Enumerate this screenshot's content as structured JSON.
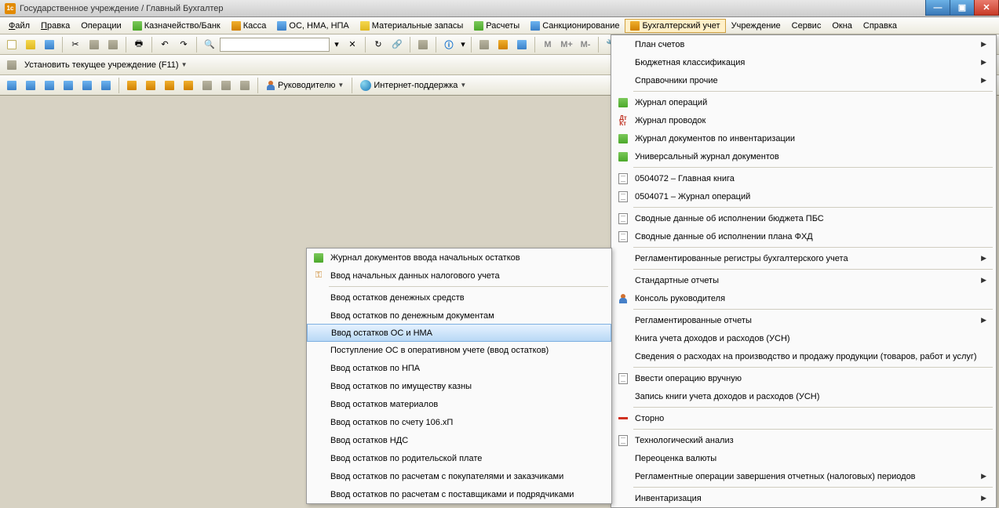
{
  "titlebar": {
    "title": "Государственное учреждение / Главный Бухгалтер"
  },
  "menubar": {
    "items": [
      {
        "label": "Файл",
        "u": 0
      },
      {
        "label": "Правка",
        "u": 0
      },
      {
        "label": "Операции",
        "u": -1
      },
      {
        "label": "Казначейство/Банк",
        "icon": "green"
      },
      {
        "label": "Касса",
        "icon": "orange"
      },
      {
        "label": "ОС, НМА, НПА",
        "icon": "blue"
      },
      {
        "label": "Материальные запасы",
        "icon": "yellow"
      },
      {
        "label": "Расчеты",
        "icon": "green"
      },
      {
        "label": "Санкционирование",
        "icon": "blue"
      },
      {
        "label": "Бухгалтерский учет",
        "icon": "orange",
        "active": true
      },
      {
        "label": "Учреждение",
        "u": -1
      },
      {
        "label": "Сервис",
        "u": -1
      },
      {
        "label": "Окна",
        "u": -1
      },
      {
        "label": "Справка",
        "u": -1
      }
    ]
  },
  "toolbar2": {
    "label": "Установить текущее учреждение (F11)"
  },
  "toolbar3": {
    "btn1": "Руководителю",
    "btn2": "Интернет-поддержка"
  },
  "mainMenu": {
    "items": [
      {
        "label": "План счетов",
        "arrow": true
      },
      {
        "label": "Бюджетная классификация",
        "arrow": true
      },
      {
        "label": "Справочники прочие",
        "arrow": true
      },
      {
        "sep": true
      },
      {
        "label": "Журнал операций",
        "icon": "green"
      },
      {
        "label": "Журнал проводок",
        "icon": "dtkt"
      },
      {
        "label": "Журнал документов по инвентаризации",
        "icon": "green"
      },
      {
        "label": "Универсальный журнал документов",
        "icon": "green"
      },
      {
        "sep": true
      },
      {
        "label": "0504072  –  Главная книга",
        "icon": "doc"
      },
      {
        "label": "0504071  –  Журнал операций",
        "icon": "doc"
      },
      {
        "sep": true
      },
      {
        "label": "Сводные данные об исполнении бюджета ПБС",
        "icon": "doc"
      },
      {
        "label": "Сводные данные об исполнении плана ФХД",
        "icon": "doc"
      },
      {
        "sep": true
      },
      {
        "label": "Регламентированные регистры бухгалтерского учета",
        "arrow": true
      },
      {
        "sep": true
      },
      {
        "label": "Стандартные отчеты",
        "arrow": true
      },
      {
        "label": "Консоль руководителя",
        "icon": "person"
      },
      {
        "sep": true
      },
      {
        "label": "Регламентированные отчеты",
        "arrow": true
      },
      {
        "label": "Книга учета доходов и расходов (УСН)"
      },
      {
        "label": "Сведения о расходах на производство и продажу продукции (товаров, работ и услуг)"
      },
      {
        "sep": true
      },
      {
        "label": "Ввести операцию вручную",
        "icon": "doc"
      },
      {
        "label": "Запись книги учета доходов и расходов (УСН)"
      },
      {
        "sep": true
      },
      {
        "label": "Сторно",
        "icon": "redbar"
      },
      {
        "sep": true
      },
      {
        "label": "Технологический анализ",
        "icon": "doc"
      },
      {
        "label": "Переоценка валюты"
      },
      {
        "label": "Регламентные операции завершения отчетных (налоговых) периодов",
        "arrow": true
      },
      {
        "sep": true
      },
      {
        "label": "Инвентаризация",
        "arrow": true
      }
    ]
  },
  "subMenu": {
    "items": [
      {
        "label": "Журнал документов ввода начальных остатков",
        "icon": "green"
      },
      {
        "label": "Ввод начальных данных налогового учета",
        "icon": "key"
      },
      {
        "sep": true
      },
      {
        "label": "Ввод остатков денежных средств"
      },
      {
        "label": "Ввод остатков по денежным документам"
      },
      {
        "label": "Ввод остатков ОС и НМА",
        "hl": true
      },
      {
        "label": "Поступление ОС в оперативном учете (ввод остатков)"
      },
      {
        "label": "Ввод остатков по НПА"
      },
      {
        "label": "Ввод остатков по имуществу казны"
      },
      {
        "label": "Ввод остатков материалов"
      },
      {
        "label": "Ввод остатков по счету 106.хП"
      },
      {
        "label": "Ввод остатков НДС"
      },
      {
        "label": "Ввод остатков по родительской плате"
      },
      {
        "label": "Ввод остатков по расчетам с покупателями и заказчиками"
      },
      {
        "label": "Ввод остатков по расчетам с поставщиками и подрядчиками"
      }
    ]
  }
}
